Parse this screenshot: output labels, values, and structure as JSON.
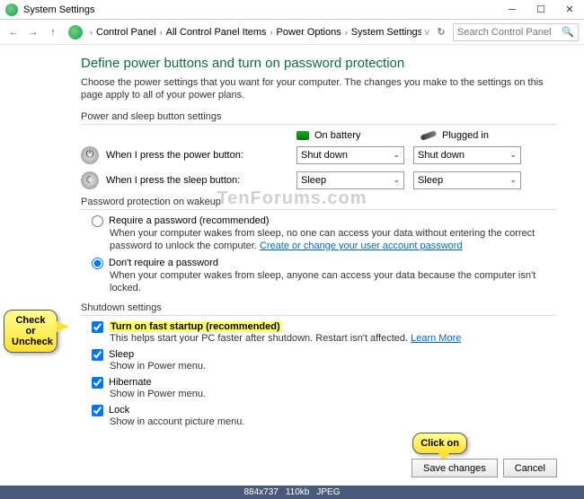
{
  "window": {
    "title": "System Settings"
  },
  "breadcrumb": {
    "items": [
      "Control Panel",
      "All Control Panel Items",
      "Power Options",
      "System Settings"
    ]
  },
  "search": {
    "placeholder": "Search Control Panel"
  },
  "heading": "Define power buttons and turn on password protection",
  "description": "Choose the power settings that you want for your computer. The changes you make to the settings on this page apply to all of your power plans.",
  "section_power": "Power and sleep button settings",
  "cols": {
    "battery": "On battery",
    "plugged": "Plugged in"
  },
  "rows": {
    "power_btn": {
      "label": "When I press the power button:",
      "battery": "Shut down",
      "plugged": "Shut down"
    },
    "sleep_btn": {
      "label": "When I press the sleep button:",
      "battery": "Sleep",
      "plugged": "Sleep"
    }
  },
  "section_pass": "Password protection on wakeup",
  "radio": {
    "req": {
      "label": "Require a password (recommended)",
      "sub": "When your computer wakes from sleep, no one can access your data without entering the correct password to unlock the computer.",
      "link": "Create or change your user account password"
    },
    "noreq": {
      "label": "Don't require a password",
      "sub": "When your computer wakes from sleep, anyone can access your data because the computer isn't locked."
    }
  },
  "section_shut": "Shutdown settings",
  "chk": {
    "fast": {
      "label": "Turn on fast startup (recommended)",
      "sub_pre": "This helps start your PC faster after shutdown. Restart isn't affected.",
      "link": "Learn More"
    },
    "sleep": {
      "label": "Sleep",
      "sub": "Show in Power menu."
    },
    "hib": {
      "label": "Hibernate",
      "sub": "Show in Power menu."
    },
    "lock": {
      "label": "Lock",
      "sub": "Show in account picture menu."
    }
  },
  "buttons": {
    "save": "Save changes",
    "cancel": "Cancel"
  },
  "callouts": {
    "check": "Check or Uncheck",
    "click": "Click on"
  },
  "watermark": "TenForums.com",
  "footer": {
    "dims": "884x737",
    "size": "110kb",
    "fmt": "JPEG"
  }
}
